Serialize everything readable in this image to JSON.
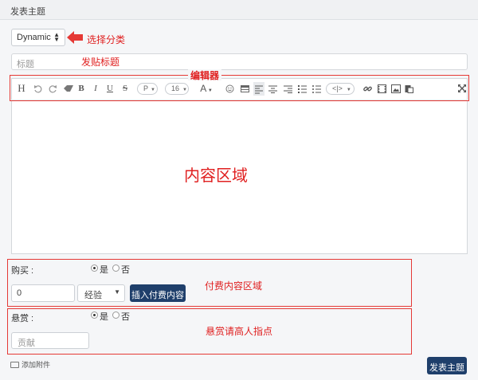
{
  "header": {
    "title": "发表主题"
  },
  "category": {
    "selected": "Dynamic",
    "annotation": "选择分类"
  },
  "title_field": {
    "placeholder": "标题",
    "annotation": "发贴标题"
  },
  "editor": {
    "annotation": "编辑器",
    "content_annotation": "内容区域",
    "toolbar": {
      "heading": "H",
      "bold": "B",
      "italic": "I",
      "underline": "U",
      "strike": "S",
      "paragraph": "P",
      "font_size": "16",
      "font_color": "A",
      "code": "<|>",
      "icons": [
        "undo-icon",
        "redo-icon",
        "eraser-icon",
        "paragraph-dropdown",
        "font-size-dropdown",
        "font-color-dropdown",
        "emoji-icon",
        "table-icon",
        "align-left-icon",
        "align-center-icon",
        "align-right-icon",
        "ordered-list-icon",
        "unordered-list-icon",
        "code-dropdown",
        "link-icon",
        "video-icon",
        "image-icon",
        "paste-icon",
        "fullscreen-icon"
      ]
    }
  },
  "purchase": {
    "label": "购买 :",
    "yes": "是",
    "no": "否",
    "amount": "0",
    "unit": "经验",
    "insert_button": "插入付费内容",
    "annotation": "付费内容区域"
  },
  "bounty": {
    "label": "悬赏 :",
    "yes": "是",
    "no": "否",
    "placeholder": "贡献",
    "annotation": "悬赏请高人指点"
  },
  "attachments": {
    "label": "添加附件"
  },
  "submit": {
    "label": "发表主题"
  },
  "colors": {
    "annotation_red": "#e02020",
    "primary": "#1f3f6b"
  }
}
